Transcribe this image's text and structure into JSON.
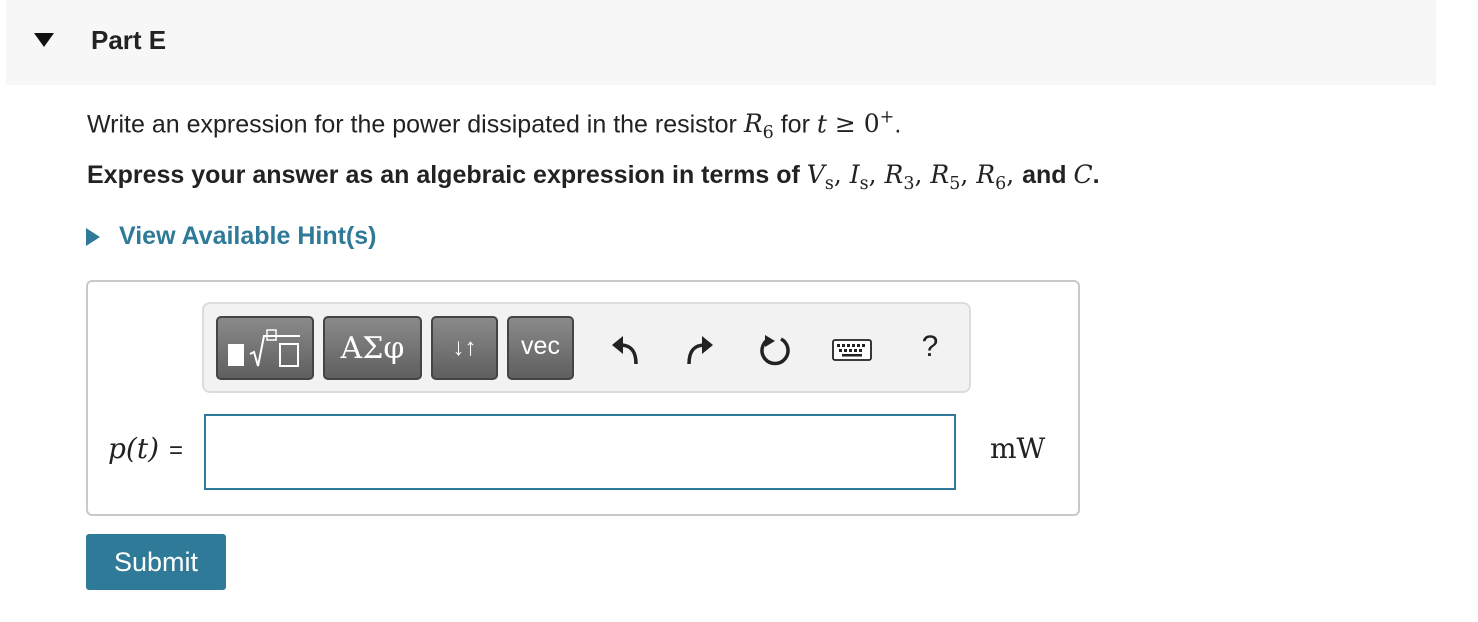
{
  "part": {
    "title": "Part E"
  },
  "question": {
    "text_before": "Write an expression for the power dissipated in the resistor ",
    "resistor_var": "R",
    "resistor_sub": "6",
    "text_for": " for ",
    "time_var": "t",
    "condition": " ≥ 0",
    "condition_sup": "+",
    "end": "."
  },
  "instruction": {
    "text": "Express your answer as an algebraic expression in terms of ",
    "vars": [
      {
        "var": "V",
        "sub": "s",
        "sep": ", "
      },
      {
        "var": "I",
        "sub": "s",
        "sep": ", "
      },
      {
        "var": "R",
        "sub": "3",
        "sep": ", "
      },
      {
        "var": "R",
        "sub": "5",
        "sep": ", "
      },
      {
        "var": "R",
        "sub": "6",
        "sep": ", "
      }
    ],
    "and": "and ",
    "last_var": "C",
    "end": "."
  },
  "hints": {
    "label": "View Available Hint(s)",
    "icon": "triangle-right-icon"
  },
  "toolbar": {
    "templates_icon": "templates-icon",
    "greek_label": "ΑΣφ",
    "arrows_label": "↓↑",
    "vec_label": "vec",
    "help_label": "?"
  },
  "answer": {
    "label_var": "p(t)",
    "label_eq": "=",
    "value": "",
    "unit": "mW"
  },
  "submit": {
    "label": "Submit"
  },
  "colors": {
    "accent": "#2f7a98",
    "header_bg": "#f7f7f7",
    "button_gray": "#6f6f6f"
  }
}
